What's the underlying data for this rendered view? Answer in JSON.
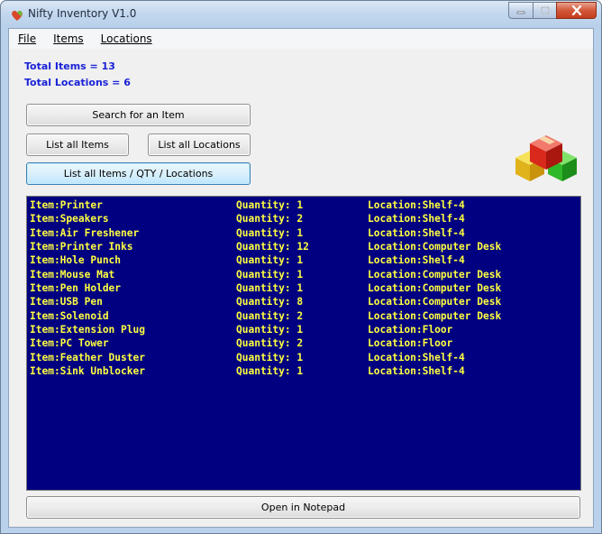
{
  "window": {
    "title": "Nifty Inventory V1.0"
  },
  "menu": {
    "file": "File",
    "items": "Items",
    "locations": "Locations"
  },
  "stats": {
    "total_items": "Total Items = 13",
    "total_locations": "Total Locations = 6"
  },
  "buttons": {
    "search": "Search for an Item",
    "list_items": "List all Items",
    "list_locations": "List all Locations",
    "list_all": "List all Items / QTY / Locations",
    "open_notepad": "Open in Notepad"
  },
  "colors": {
    "list_background": "#000080",
    "list_text": "#ffff40",
    "stats_text": "#1a22d6"
  },
  "inventory": [
    {
      "item": "Item:Printer",
      "qty": "Quantity: 1",
      "loc": "Location:Shelf-4"
    },
    {
      "item": "Item:Speakers",
      "qty": "Quantity: 2",
      "loc": "Location:Shelf-4"
    },
    {
      "item": "Item:Air Freshener",
      "qty": "Quantity: 1",
      "loc": "Location:Shelf-4"
    },
    {
      "item": "Item:Printer Inks",
      "qty": "Quantity: 12",
      "loc": "Location:Computer Desk"
    },
    {
      "item": "Item:Hole Punch",
      "qty": "Quantity: 1",
      "loc": "Location:Shelf-4"
    },
    {
      "item": "Item:Mouse Mat",
      "qty": "Quantity: 1",
      "loc": "Location:Computer Desk"
    },
    {
      "item": "Item:Pen Holder",
      "qty": "Quantity: 1",
      "loc": "Location:Computer Desk"
    },
    {
      "item": "Item:USB Pen",
      "qty": "Quantity: 8",
      "loc": "Location:Computer Desk"
    },
    {
      "item": "Item:Solenoid",
      "qty": "Quantity: 2",
      "loc": "Location:Computer Desk"
    },
    {
      "item": "Item:Extension Plug",
      "qty": "Quantity: 1",
      "loc": "Location:Floor"
    },
    {
      "item": "Item:PC Tower",
      "qty": "Quantity: 2",
      "loc": "Location:Floor"
    },
    {
      "item": "Item:Feather Duster",
      "qty": "Quantity: 1",
      "loc": "Location:Shelf-4"
    },
    {
      "item": "Item:Sink Unblocker",
      "qty": "Quantity: 1",
      "loc": "Location:Shelf-4"
    }
  ]
}
